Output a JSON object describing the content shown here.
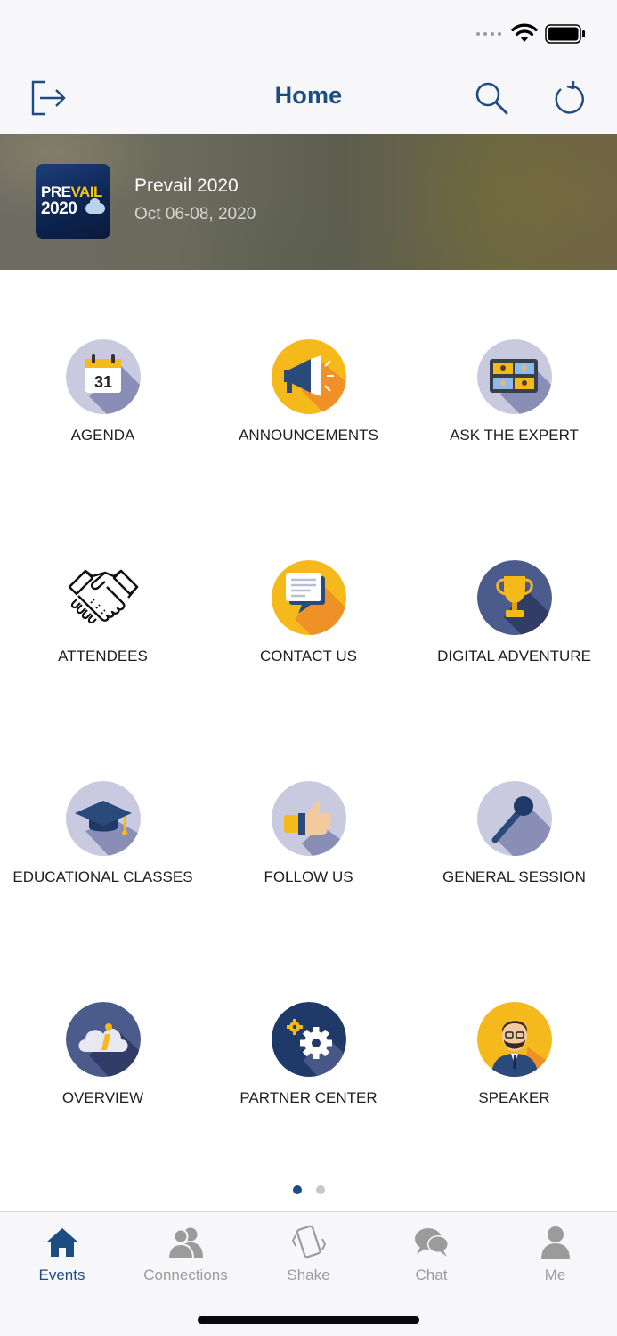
{
  "nav": {
    "title": "Home",
    "left_icon": "exit-icon",
    "right_icons": [
      "search-icon",
      "refresh-icon"
    ]
  },
  "event": {
    "name": "Prevail 2020",
    "dates": "Oct 06-08, 2020",
    "logo_text_line1_a": "PRE",
    "logo_text_line1_b": "VAIL",
    "logo_text_line2": "2020"
  },
  "tiles": [
    {
      "label": "AGENDA",
      "icon": "calendar-icon"
    },
    {
      "label": "ANNOUNCEMENTS",
      "icon": "megaphone-icon"
    },
    {
      "label": "ASK THE EXPERT",
      "icon": "video-call-icon"
    },
    {
      "label": "ATTENDEES",
      "icon": "handshake-icon"
    },
    {
      "label": "CONTACT US",
      "icon": "chat-bubble-icon"
    },
    {
      "label": "DIGITAL ADVENTURE",
      "icon": "trophy-icon"
    },
    {
      "label": "EDUCATIONAL CLASSES",
      "icon": "graduation-cap-icon"
    },
    {
      "label": "FOLLOW US",
      "icon": "thumbs-up-icon"
    },
    {
      "label": "GENERAL SESSION",
      "icon": "microphone-icon"
    },
    {
      "label": "OVERVIEW",
      "icon": "info-cloud-icon"
    },
    {
      "label": "PARTNER CENTER",
      "icon": "gears-icon"
    },
    {
      "label": "SPEAKER",
      "icon": "speaker-person-icon"
    }
  ],
  "calendar_day": "31",
  "pager": {
    "pages": 2,
    "current": 1
  },
  "tabs": [
    {
      "label": "Events",
      "icon": "home-icon",
      "active": true
    },
    {
      "label": "Connections",
      "icon": "people-icon",
      "active": false
    },
    {
      "label": "Shake",
      "icon": "shake-phone-icon",
      "active": false
    },
    {
      "label": "Chat",
      "icon": "chat-icon",
      "active": false
    },
    {
      "label": "Me",
      "icon": "person-icon",
      "active": false
    }
  ],
  "colors": {
    "accent": "#1d4c82",
    "tab_inactive": "#9b9b9b",
    "icon_lavender": "#c9c9e0",
    "icon_yellow": "#f6b91c",
    "icon_navy": "#4b5b8c"
  }
}
